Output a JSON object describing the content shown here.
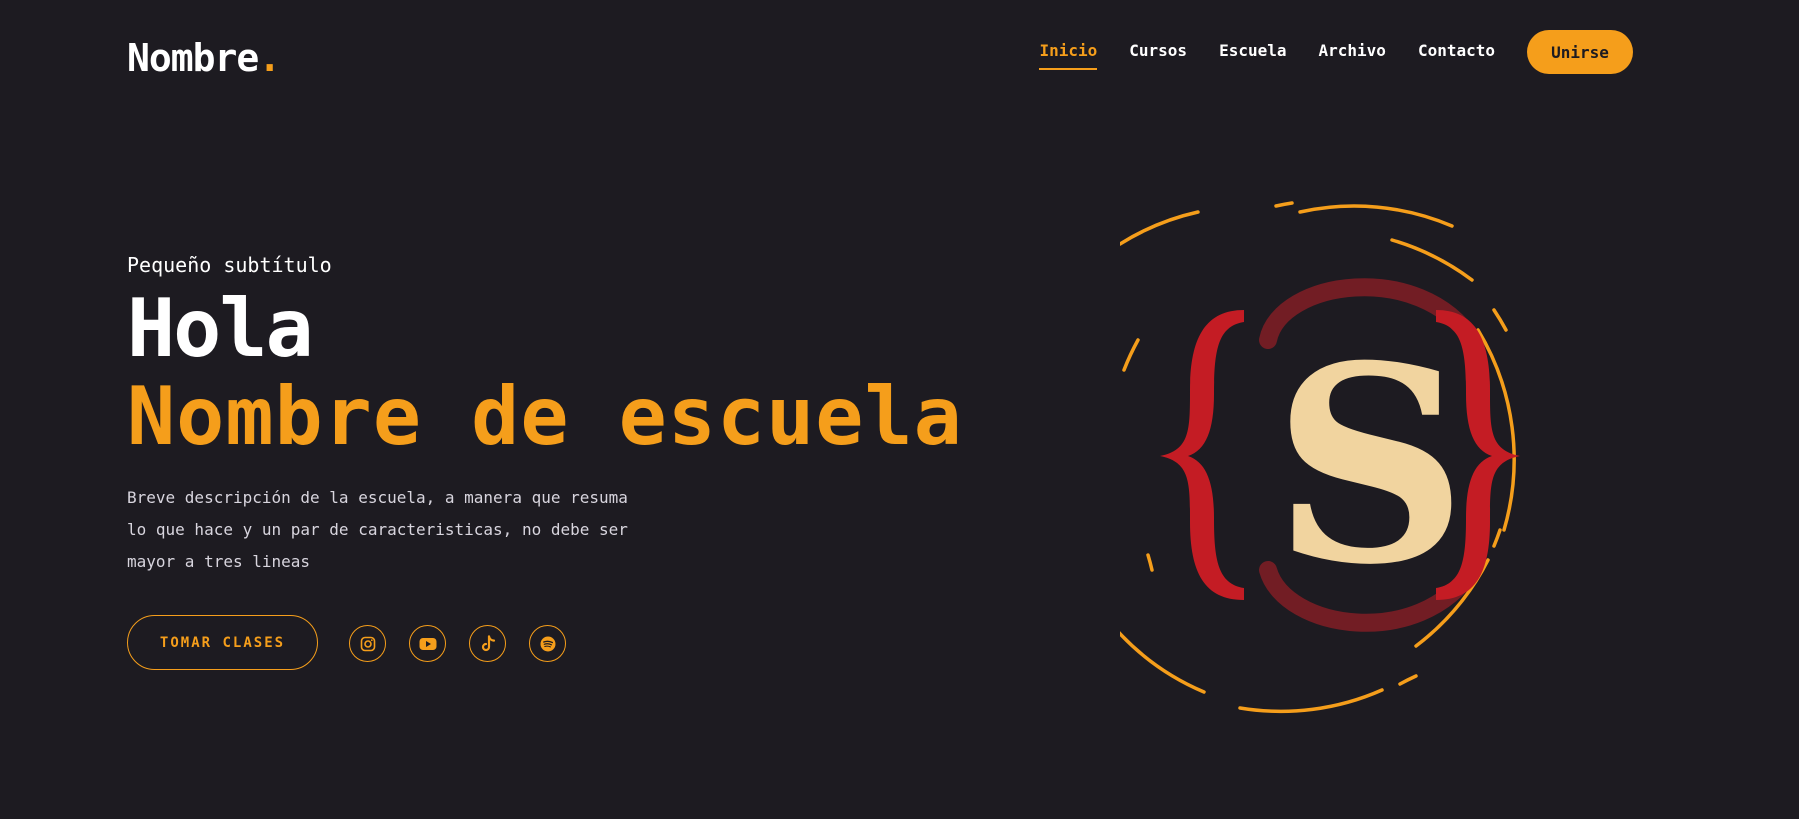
{
  "header": {
    "logo_text": "Nombre",
    "logo_dot": ".",
    "nav": [
      {
        "label": "Inicio",
        "active": true
      },
      {
        "label": "Cursos",
        "active": false
      },
      {
        "label": "Escuela",
        "active": false
      },
      {
        "label": "Archivo",
        "active": false
      },
      {
        "label": "Contacto",
        "active": false
      }
    ],
    "join_label": "Unirse"
  },
  "hero": {
    "subtitle": "Pequeño subtítulo",
    "greeting": "Hola",
    "school_name": "Nombre de escuela",
    "description": "Breve descripción de la escuela, a manera que resuma lo que hace y un par de caracteristicas, no debe ser mayor a tres lineas",
    "cta_label": "TOMAR CLASES",
    "socials": [
      "instagram-icon",
      "youtube-icon",
      "tiktok-icon",
      "spotify-icon"
    ]
  },
  "emblem": {
    "letter": "S"
  },
  "colors": {
    "background": "#1d1b21",
    "accent": "#f59e1b",
    "brace_red": "#c41c24",
    "arc_dark_red": "#721d24",
    "letter_cream": "#f1d49f"
  }
}
